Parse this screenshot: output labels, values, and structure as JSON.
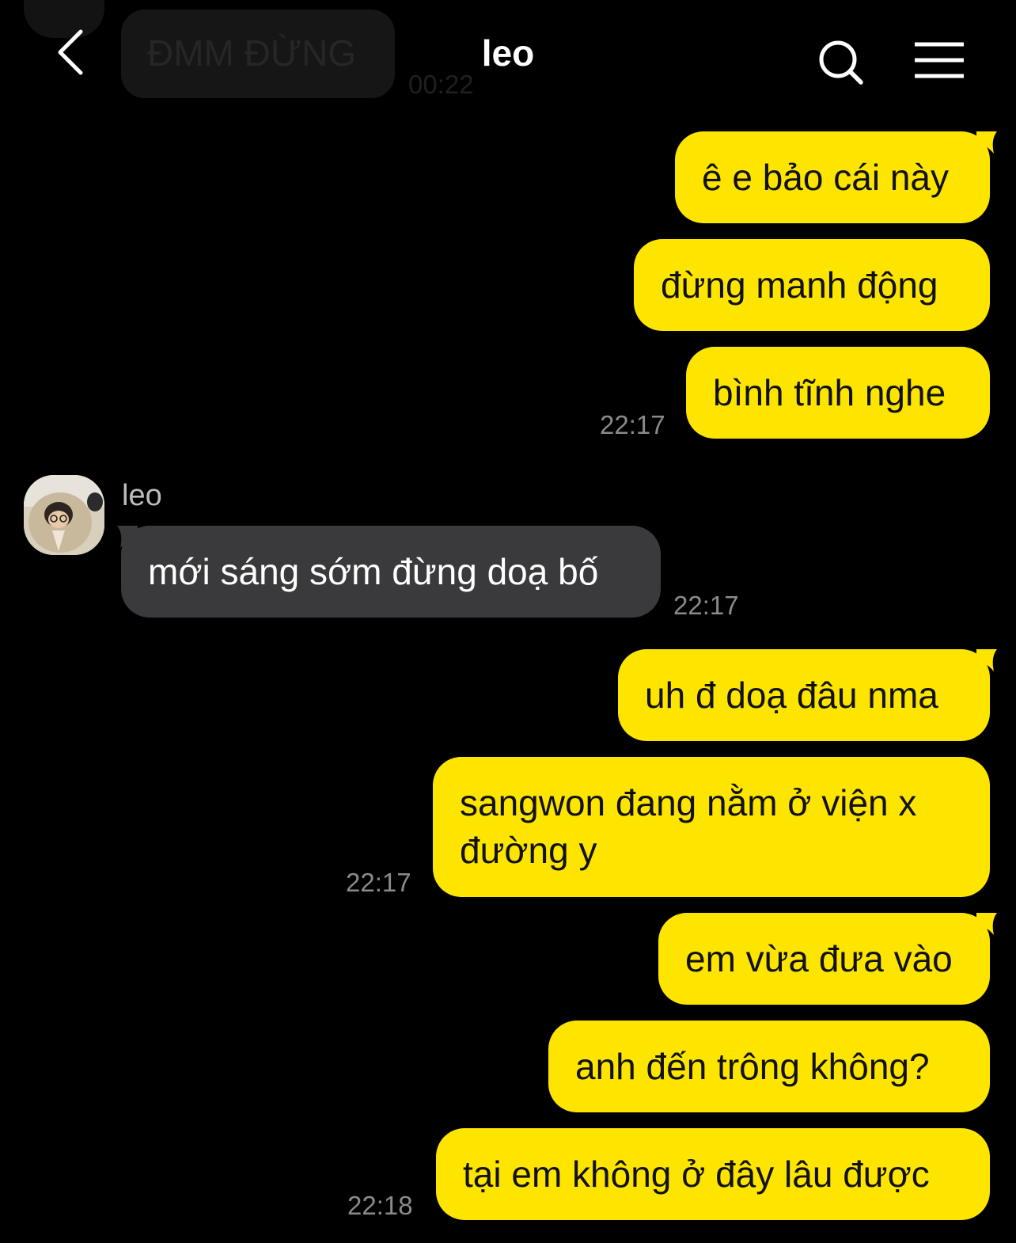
{
  "header": {
    "title": "leo"
  },
  "previous": {
    "text": "ĐMM ĐỪNG",
    "time": "00:22"
  },
  "messages": [
    {
      "text": "ê e bảo cái này"
    },
    {
      "text": "đừng manh động"
    },
    {
      "text": "bình tĩnh nghe",
      "time": "22:17"
    },
    {
      "sender": "leo",
      "text": "mới sáng sớm đừng doạ bố",
      "time": "22:17"
    },
    {
      "text": "uh đ doạ đâu nma"
    },
    {
      "text_line1": "sangwon đang nằm ở viện x",
      "text_line2": "đường y",
      "time": "22:17"
    },
    {
      "text": "em vừa đưa vào"
    },
    {
      "text": "anh đến trông không?"
    },
    {
      "text": "tại em không ở đây lâu được",
      "time": "22:18"
    }
  ],
  "colors": {
    "background": "#000000",
    "my_bubble": "#fee500",
    "their_bubble": "#3a3a3c",
    "timestamp": "#8a8a8a"
  },
  "icons": {
    "back": "chevron-left-icon",
    "search": "search-icon",
    "menu": "hamburger-menu-icon"
  }
}
